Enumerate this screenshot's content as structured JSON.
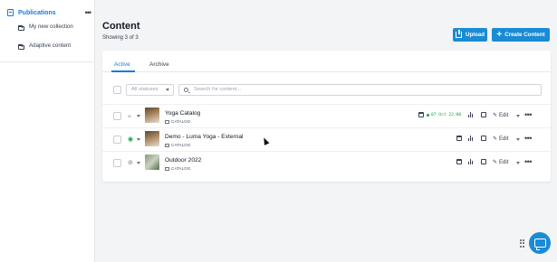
{
  "sidebar": {
    "title": "Publications",
    "items": [
      {
        "label": "My new collection"
      },
      {
        "label": "Adaptive content"
      }
    ]
  },
  "header": {
    "title": "Content",
    "showing": "Showing 3 of 3",
    "upload_label": "Upload",
    "create_label": "Create Content"
  },
  "tabs": {
    "active": "Active",
    "archive": "Archive"
  },
  "filters": {
    "status_value": "All statuses",
    "search_placeholder": "Search for content..."
  },
  "rows": [
    {
      "name": "Yoga Catalog",
      "type": "CATALOG",
      "schedule": "07 Oct 22:00",
      "status": "unpublished"
    },
    {
      "name": "Demo - Luma Yoga - External",
      "type": "CATALOG",
      "status": "published"
    },
    {
      "name": "Outdoor 2022",
      "type": "CATALOG",
      "status": "draft"
    }
  ],
  "actions": {
    "edit_label": "Edit"
  },
  "colors": {
    "accent": "#1a8bd5",
    "published": "#16a34a"
  }
}
